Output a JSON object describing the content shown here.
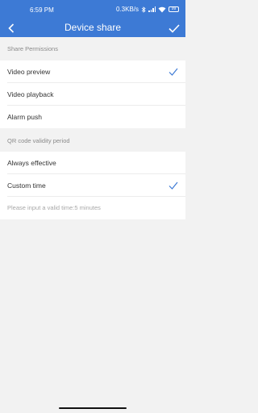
{
  "status_bar": {
    "time": "6:59 PM",
    "network_speed": "0.3KB/s",
    "bluetooth_icon": "bluetooth-icon",
    "signal_icon": "cellular-signal-icon",
    "wifi_icon": "wifi-icon",
    "battery_label": "99"
  },
  "nav": {
    "title": "Device share",
    "back_icon": "back-chevron-icon",
    "confirm_icon": "checkmark-icon"
  },
  "sections": {
    "permissions": {
      "header": "Share Permissions",
      "items": [
        {
          "label": "Video preview",
          "checked": true
        },
        {
          "label": "Video playback",
          "checked": false
        },
        {
          "label": "Alarm push",
          "checked": false
        }
      ]
    },
    "validity": {
      "header": "QR code validity period",
      "items": [
        {
          "label": "Always effective",
          "checked": false
        },
        {
          "label": "Custom time",
          "checked": true
        }
      ],
      "hint": "Please input a valid time:5 minutes"
    }
  },
  "colors": {
    "primary": "#3d7ad5",
    "check": "#3d7ad5",
    "background": "#f2f2f2"
  }
}
